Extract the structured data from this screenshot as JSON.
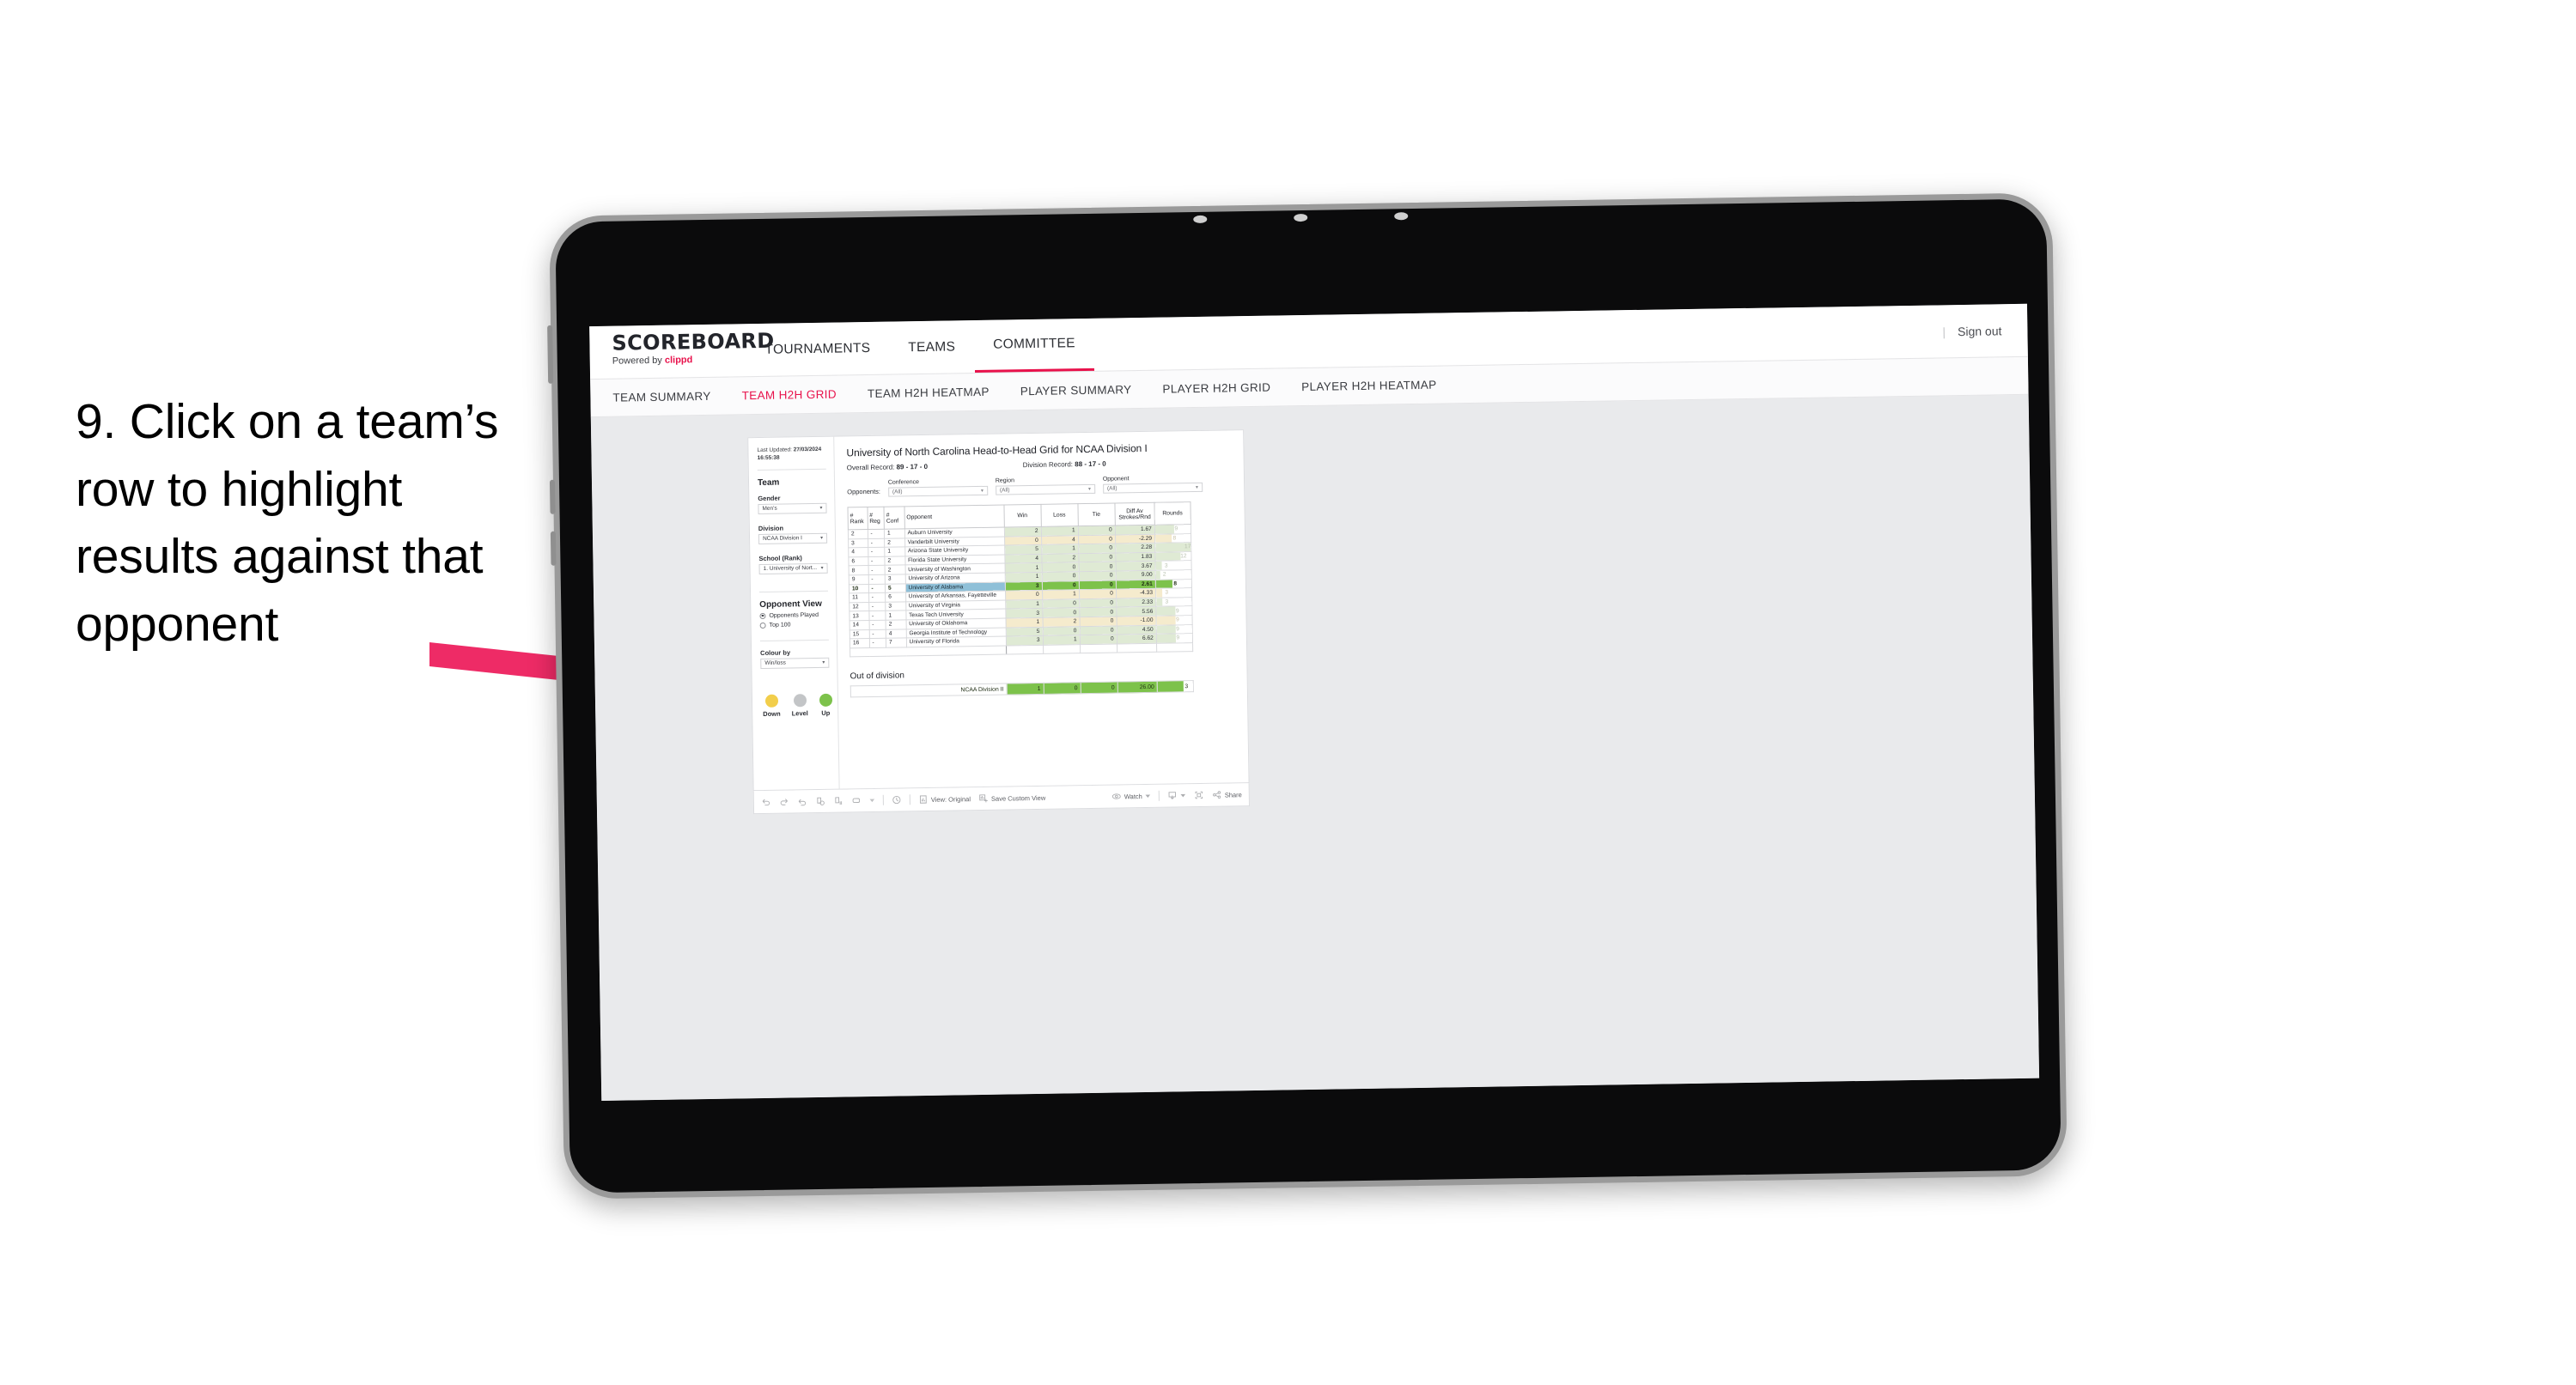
{
  "annotation": {
    "text": "9. Click on a team’s row to highlight results against that opponent",
    "arrow_color": "#EE2B66"
  },
  "navbar": {
    "brand_title": "SCOREBOARD",
    "brand_sub_prefix": "Powered by ",
    "brand_sub_name": "clippd",
    "tabs": [
      {
        "label": "TOURNAMENTS",
        "active": false
      },
      {
        "label": "TEAMS",
        "active": false
      },
      {
        "label": "COMMITTEE",
        "active": true
      }
    ],
    "separator": "|",
    "sign_out": "Sign out",
    "accent": "#E8114B"
  },
  "subnav": {
    "items": [
      {
        "label": "TEAM SUMMARY",
        "active": false
      },
      {
        "label": "TEAM H2H GRID",
        "active": true
      },
      {
        "label": "TEAM H2H HEATMAP",
        "active": false
      },
      {
        "label": "PLAYER SUMMARY",
        "active": false
      },
      {
        "label": "PLAYER H2H GRID",
        "active": false
      },
      {
        "label": "PLAYER H2H HEATMAP",
        "active": false
      }
    ]
  },
  "sidebar": {
    "last_updated_label": "Last Updated:",
    "last_updated_date": "27/03/2024",
    "last_updated_time": "16:55:38",
    "team_heading": "Team",
    "gender_label": "Gender",
    "gender_value": "Men’s",
    "division_label": "Division",
    "division_value": "NCAA Division I",
    "school_label": "School (Rank)",
    "school_value": "1. University of Nort...",
    "opponent_view_heading": "Opponent View",
    "radio_options": [
      {
        "label": "Opponents Played",
        "selected": true
      },
      {
        "label": "Top 100",
        "selected": false
      }
    ],
    "colour_by_label": "Colour by",
    "colour_by_value": "Win/loss",
    "legend": [
      {
        "label": "Down",
        "color": "#F2CE4B"
      },
      {
        "label": "Level",
        "color": "#C3C5C7"
      },
      {
        "label": "Up",
        "color": "#7DC24B"
      }
    ]
  },
  "main": {
    "title": "University of North Carolina Head-to-Head Grid for NCAA Division I",
    "overall_record_label": "Overall Record:",
    "overall_record_value": "89 - 17 - 0",
    "division_record_label": "Division Record:",
    "division_record_value": "88 - 17 - 0",
    "opponents_label": "Opponents:",
    "filters": [
      {
        "label": "Conference",
        "value": "(All)"
      },
      {
        "label": "Region",
        "value": "(All)"
      },
      {
        "label": "Opponent",
        "value": "(All)"
      }
    ],
    "columns": [
      "# Rank",
      "# Reg",
      "# Conf",
      "Opponent",
      "Win",
      "Loss",
      "Tie",
      "Diff Av Strokes/Rnd",
      "Rounds"
    ],
    "column_parts": {
      "rank": [
        "#",
        "Rank"
      ],
      "reg": [
        "#",
        "Reg"
      ],
      "conf": [
        "#",
        "Conf"
      ],
      "opponent": "Opponent",
      "win": "Win",
      "loss": "Loss",
      "tie": "Tie",
      "diff": [
        "Diff Av",
        "Strokes/Rnd"
      ],
      "rounds": "Rounds"
    },
    "rows": [
      {
        "rank": "2",
        "reg": "-",
        "conf": "1",
        "opponent": "Auburn University",
        "win": "2",
        "loss": "1",
        "tie": "0",
        "diff": "1.67",
        "rounds": "9",
        "tone": "up",
        "bar_pct": 53,
        "highlighted": false
      },
      {
        "rank": "3",
        "reg": "-",
        "conf": "2",
        "opponent": "Vanderbilt University",
        "win": "0",
        "loss": "4",
        "tie": "0",
        "diff": "-2.29",
        "rounds": "8",
        "tone": "down",
        "bar_pct": 47,
        "highlighted": false
      },
      {
        "rank": "4",
        "reg": "-",
        "conf": "1",
        "opponent": "Arizona State University",
        "win": "5",
        "loss": "1",
        "tie": "0",
        "diff": "2.28",
        "rounds": "17",
        "tone": "up",
        "bar_pct": 100,
        "highlighted": false
      },
      {
        "rank": "6",
        "reg": "-",
        "conf": "2",
        "opponent": "Florida State University",
        "win": "4",
        "loss": "2",
        "tie": "0",
        "diff": "1.83",
        "rounds": "12",
        "tone": "up",
        "bar_pct": 71,
        "highlighted": false
      },
      {
        "rank": "8",
        "reg": "-",
        "conf": "2",
        "opponent": "University of Washington",
        "win": "1",
        "loss": "0",
        "tie": "0",
        "diff": "3.67",
        "rounds": "3",
        "tone": "up",
        "bar_pct": 18,
        "highlighted": false
      },
      {
        "rank": "9",
        "reg": "-",
        "conf": "3",
        "opponent": "University of Arizona",
        "win": "1",
        "loss": "0",
        "tie": "0",
        "diff": "9.00",
        "rounds": "2",
        "tone": "up",
        "bar_pct": 12,
        "highlighted": false
      },
      {
        "rank": "10",
        "reg": "-",
        "conf": "5",
        "opponent": "University of Alabama",
        "win": "3",
        "loss": "0",
        "tie": "0",
        "diff": "2.61",
        "rounds": "8",
        "tone": "up",
        "bar_pct": 47,
        "highlighted": true
      },
      {
        "rank": "11",
        "reg": "-",
        "conf": "6",
        "opponent": "University of Arkansas, Fayetteville",
        "win": "0",
        "loss": "1",
        "tie": "0",
        "diff": "-4.33",
        "rounds": "3",
        "tone": "down",
        "bar_pct": 18,
        "highlighted": false
      },
      {
        "rank": "12",
        "reg": "-",
        "conf": "3",
        "opponent": "University of Virginia",
        "win": "1",
        "loss": "0",
        "tie": "0",
        "diff": "2.33",
        "rounds": "3",
        "tone": "up",
        "bar_pct": 18,
        "highlighted": false
      },
      {
        "rank": "13",
        "reg": "-",
        "conf": "1",
        "opponent": "Texas Tech University",
        "win": "3",
        "loss": "0",
        "tie": "0",
        "diff": "5.56",
        "rounds": "9",
        "tone": "up",
        "bar_pct": 53,
        "highlighted": false
      },
      {
        "rank": "14",
        "reg": "-",
        "conf": "2",
        "opponent": "University of Oklahoma",
        "win": "1",
        "loss": "2",
        "tie": "0",
        "diff": "-1.00",
        "rounds": "9",
        "tone": "down",
        "bar_pct": 53,
        "highlighted": false
      },
      {
        "rank": "15",
        "reg": "-",
        "conf": "4",
        "opponent": "Georgia Institute of Technology",
        "win": "5",
        "loss": "0",
        "tie": "0",
        "diff": "4.50",
        "rounds": "9",
        "tone": "up",
        "bar_pct": 53,
        "highlighted": false
      },
      {
        "rank": "16",
        "reg": "-",
        "conf": "7",
        "opponent": "University of Florida",
        "win": "3",
        "loss": "1",
        "tie": "0",
        "diff": "6.62",
        "rounds": "9",
        "tone": "up",
        "bar_pct": 53,
        "highlighted": false
      }
    ],
    "out_of_division_heading": "Out of division",
    "out_of_division_row": {
      "label": "NCAA Division II",
      "win": "1",
      "loss": "0",
      "tie": "0",
      "diff": "26.00",
      "rounds": "3",
      "bar_pct": 72
    }
  },
  "toolbar": {
    "view_label": "View: Original",
    "save_custom_view_label": "Save Custom View",
    "watch_label": "Watch",
    "share_label": "Share"
  },
  "colors": {
    "highlight_row": "#8FC0D8",
    "bar_green": "#7DC24B",
    "faint_green": "#DFEAD4",
    "faint_yellow": "#F5EBCD",
    "accent_pink": "#E8114B"
  }
}
